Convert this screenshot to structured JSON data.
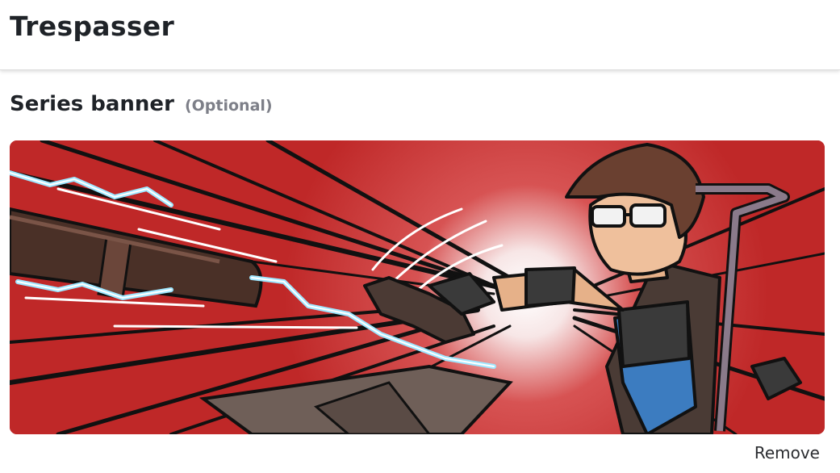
{
  "header": {
    "title": "Trespasser"
  },
  "banner_section": {
    "heading": "Series banner",
    "optional_label": "(Optional)",
    "remove_label": "Remove",
    "image_description_icon": "series-banner-image"
  },
  "colors": {
    "banner_red": "#c32b2b",
    "text": "#1f2328",
    "muted": "#7d7f88"
  }
}
